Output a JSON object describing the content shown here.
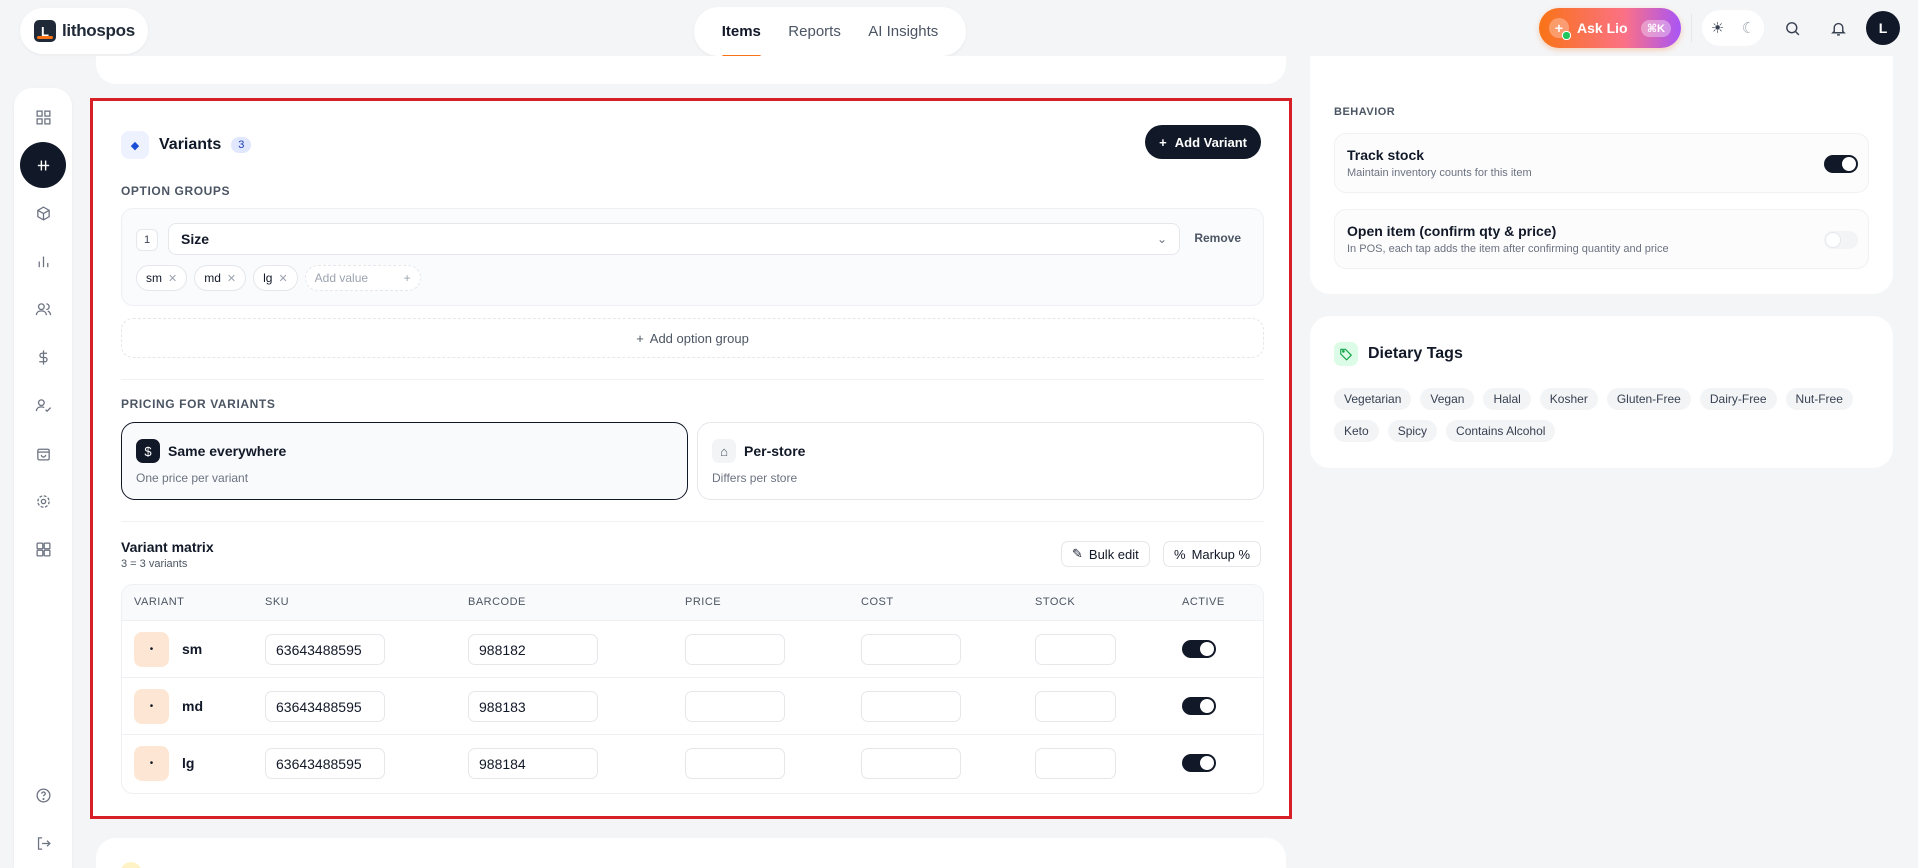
{
  "app": {
    "logo_mark": "L",
    "logo_text": "lithospos"
  },
  "nav": {
    "tabs": [
      {
        "label": "Items"
      },
      {
        "label": "Reports"
      },
      {
        "label": "AI Insights"
      }
    ]
  },
  "top_right": {
    "ask_label": "Ask Lio",
    "ask_badge": "⌘K",
    "avatar_initial": "L"
  },
  "variants": {
    "title": "Variants",
    "count": "3",
    "add_label": "Add Variant",
    "option_groups_label": "OPTION GROUPS",
    "group": {
      "index": "1",
      "name": "Size",
      "remove_label": "Remove",
      "values": [
        "sm",
        "md",
        "lg"
      ],
      "add_value_placeholder": "Add value"
    },
    "add_option_group_label": "Add option group",
    "pricing_label": "PRICING FOR VARIANTS",
    "pricing_options": [
      {
        "title": "Same everywhere",
        "sub": "One price per variant",
        "selected": true
      },
      {
        "title": "Per-store",
        "sub": "Differs per store",
        "selected": false
      }
    ],
    "matrix_title": "Variant matrix",
    "matrix_sub": "3 = 3 variants",
    "bulk_edit_label": "Bulk edit",
    "markup_label": "Markup %",
    "columns": [
      "VARIANT",
      "SKU",
      "BARCODE",
      "PRICE",
      "COST",
      "STOCK",
      "ACTIVE"
    ],
    "rows": [
      {
        "name": "sm",
        "swatch": "•",
        "sku": "63643488595",
        "barcode": "988182",
        "price": "",
        "cost": "",
        "stock": "",
        "active": true
      },
      {
        "name": "md",
        "swatch": "•",
        "sku": "63643488595",
        "barcode": "988183",
        "price": "",
        "cost": "",
        "stock": "",
        "active": true
      },
      {
        "name": "lg",
        "swatch": "•",
        "sku": "63643488595",
        "barcode": "988184",
        "price": "",
        "cost": "",
        "stock": "",
        "active": true
      }
    ]
  },
  "behavior": {
    "label": "BEHAVIOR",
    "items": [
      {
        "title": "Track stock",
        "sub": "Maintain inventory counts for this item",
        "on": true
      },
      {
        "title": "Open item (confirm qty & price)",
        "sub": "In POS, each tap adds the item after confirming quantity and price",
        "on": false
      }
    ]
  },
  "dietary": {
    "title": "Dietary Tags",
    "tags": [
      "Vegetarian",
      "Vegan",
      "Halal",
      "Kosher",
      "Gluten-Free",
      "Dairy-Free",
      "Nut-Free",
      "Keto",
      "Spicy",
      "Contains Alcohol"
    ]
  },
  "colors": {
    "accent": "#f97316",
    "dark": "#111827",
    "highlight_border": "#d61f26"
  }
}
